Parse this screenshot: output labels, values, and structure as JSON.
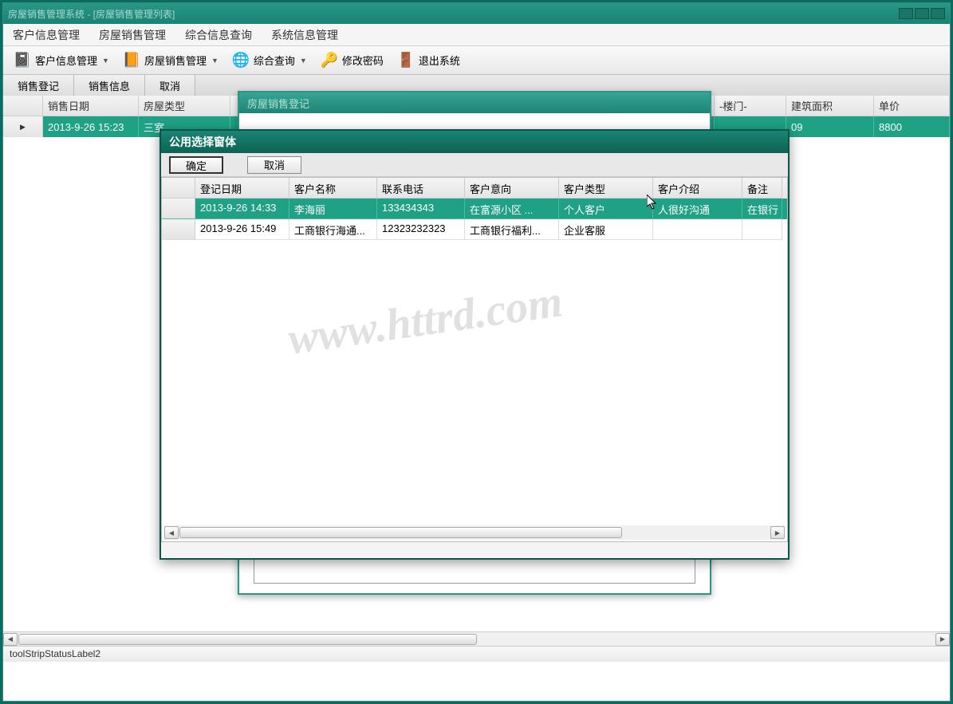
{
  "window": {
    "title": "房屋销售管理系统 - [房屋销售管理列表]"
  },
  "menu": {
    "items": [
      "客户信息管理",
      "房屋销售管理",
      "综合信息查询",
      "系统信息管理"
    ]
  },
  "toolbar": {
    "items": [
      {
        "label": "客户信息管理",
        "icon": "📓",
        "drop": true
      },
      {
        "label": "房屋销售管理",
        "icon": "📙",
        "drop": true
      },
      {
        "label": "综合查询",
        "icon": "🌐",
        "drop": true
      },
      {
        "label": "修改密码",
        "icon": "🔑",
        "drop": false
      },
      {
        "label": "退出系统",
        "icon": "🚪",
        "drop": false
      }
    ]
  },
  "tabs": {
    "items": [
      "销售登记",
      "销售信息",
      "取消"
    ]
  },
  "grid": {
    "headers": {
      "sale_date": "销售日期",
      "house_type": "房屋类型",
      "floor": "-楼门-",
      "area": "建筑面积",
      "unit_price": "单价"
    },
    "row": {
      "sale_date": "2013-9-26 15:23",
      "house_type": "三室",
      "floor": "",
      "area": "09",
      "unit_price": "8800"
    }
  },
  "bg_dialog": {
    "title": "房屋销售登记"
  },
  "selector": {
    "title": "公用选择窗体",
    "confirm": "确定",
    "cancel": "取消",
    "headers": {
      "reg_date": "登记日期",
      "cust_name": "客户名称",
      "phone": "联系电话",
      "intent": "客户意向",
      "cust_type": "客户类型",
      "intro": "客户介绍",
      "note": "备注"
    },
    "rows": [
      {
        "reg_date": "2013-9-26 14:33",
        "cust_name": "李海丽",
        "phone": "133434343",
        "intent": "在富源小区 ...",
        "cust_type": "个人客户",
        "intro": "人很好沟通",
        "note": "在银行"
      },
      {
        "reg_date": "2013-9-26 15:49",
        "cust_name": "工商银行海通...",
        "phone": "12323232323",
        "intent": "工商银行福利...",
        "cust_type": "企业客服",
        "intro": "",
        "note": ""
      }
    ]
  },
  "status": {
    "label": "toolStripStatusLabel2"
  },
  "watermark": "www.httrd.com"
}
